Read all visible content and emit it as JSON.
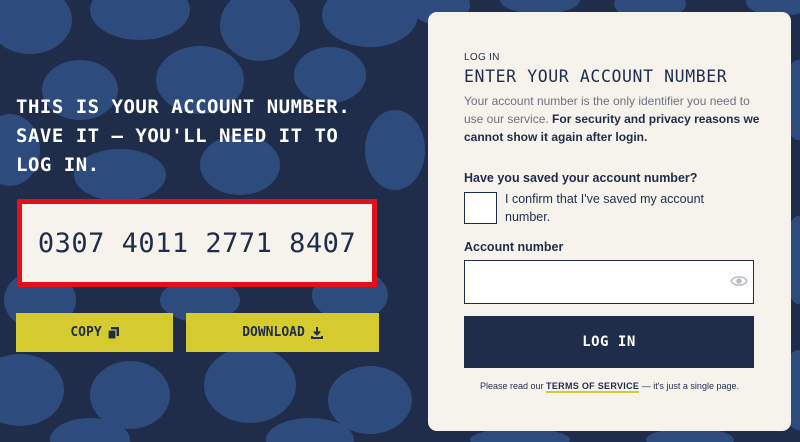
{
  "left": {
    "headline_line1": "THIS IS YOUR ACCOUNT NUMBER.",
    "headline_line2": "SAVE IT — YOU'LL NEED IT TO",
    "headline_line3": "LOG IN.",
    "account_number": "0307 4011 2771 8407",
    "copy_label": "COPY",
    "copy_icon": "copy-icon",
    "download_label": "DOWNLOAD",
    "download_icon": "download-icon"
  },
  "card": {
    "eyebrow": "LOG IN",
    "title": "ENTER YOUR ACCOUNT NUMBER",
    "desc_plain": "Your account number is the only identifier you need to use our service. ",
    "desc_bold": "For security and privacy reasons we cannot show it again after login.",
    "saved_question": "Have you saved your account number?",
    "confirm_text": "I confirm that I've saved my account number.",
    "account_label": "Account number",
    "account_value": "",
    "eye_icon": "eye-icon",
    "login_label": "LOG IN",
    "tos_prefix": "Please read our ",
    "tos_link": "TERMS OF SERVICE",
    "tos_suffix": " — it's just a single page."
  },
  "colors": {
    "background": "#1f2d4a",
    "blob": "#2e4b7d",
    "accent_yellow": "#d6cb2e",
    "highlight_red": "#e3101c",
    "card_bg": "#f5f3ec"
  }
}
